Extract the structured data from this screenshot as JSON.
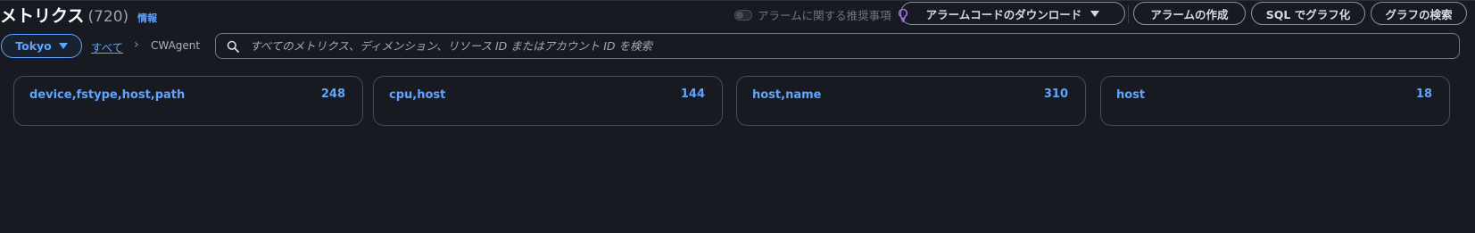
{
  "header": {
    "title": "メトリクス",
    "count": "(720)",
    "info_link": "情報",
    "alarm_toggle_label": "アラームに関する推奨事項",
    "buttons": {
      "download_alarm_code": "アラームコードのダウンロード",
      "create_alarm": "アラームの作成",
      "sql_graph": "SQL でグラフ化",
      "search_graph": "グラフの検索"
    }
  },
  "filter": {
    "region": "Tokyo",
    "breadcrumb_all": "すべて",
    "breadcrumb_separator": "›",
    "breadcrumb_current": "CWAgent",
    "search_placeholder": "すべてのメトリクス、ディメンション、リソース ID またはアカウント ID を検索"
  },
  "cards": [
    {
      "name": "device,fstype,host,path",
      "count": "248"
    },
    {
      "name": "cpu,host",
      "count": "144"
    },
    {
      "name": "host,name",
      "count": "310"
    },
    {
      "name": "host",
      "count": "18"
    }
  ],
  "icons": {
    "toggle": "toggle-switch-icon",
    "bulb": "lightbulb-icon",
    "caret": "caret-down-icon",
    "chevron": "chevron-right-icon",
    "search": "search-icon"
  },
  "colors": {
    "background": "#171a21",
    "accent": "#5fa5ff",
    "bulb": "#a66bff",
    "button_border": "#8b939f"
  }
}
